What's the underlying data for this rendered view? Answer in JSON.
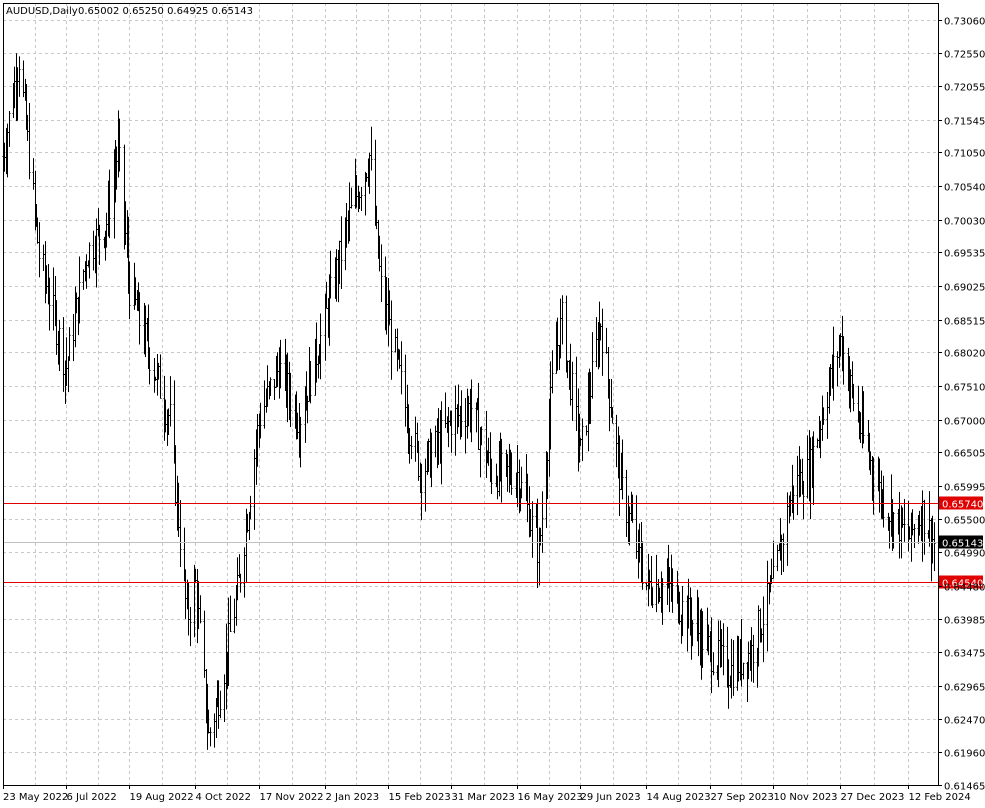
{
  "header": {
    "symbol": "AUDUSD,Daily",
    "ohlc": "0.65002 0.65250 0.64925 0.65143"
  },
  "colors": {
    "background": "#ffffff",
    "grid": "#c8c8c8",
    "bars": "#000000",
    "level_line": "#e00000",
    "current_line": "#c0c0c0"
  },
  "chart_data": {
    "type": "bar",
    "ylim": [
      0.61465,
      0.7331
    ],
    "yticks": [
      "0.73060",
      "0.72550",
      "0.72055",
      "0.71545",
      "0.71050",
      "0.70540",
      "0.70030",
      "0.69535",
      "0.69025",
      "0.68515",
      "0.68020",
      "0.67510",
      "0.67000",
      "0.66505",
      "0.65995",
      "0.65500",
      "0.64990",
      "0.64480",
      "0.63985",
      "0.63475",
      "0.62965",
      "0.62470",
      "0.61960",
      "0.61465"
    ],
    "xticks": [
      "23 May 2022",
      "6 Jul 2022",
      "19 Aug 2022",
      "4 Oct 2022",
      "17 Nov 2022",
      "2 Jan 2023",
      "15 Feb 2023",
      "31 Mar 2023",
      "16 May 2023",
      "29 Jun 2023",
      "14 Aug 2023",
      "27 Sep 2023",
      "10 Nov 2023",
      "27 Dec 2023",
      "12 Feb 2024"
    ],
    "anchors": [
      [
        "23 May 2022",
        0.71
      ],
      [
        "3 Jun 2022",
        0.725
      ],
      [
        "17 Jun 2022",
        0.695
      ],
      [
        "6 Jul 2022",
        0.678
      ],
      [
        "20 Jul 2022",
        0.695
      ],
      [
        "3 Aug 2022",
        0.7
      ],
      [
        "11 Aug 2022",
        0.711
      ],
      [
        "19 Aug 2022",
        0.69
      ],
      [
        "2 Sep 2022",
        0.68
      ],
      [
        "16 Sep 2022",
        0.67
      ],
      [
        "28 Sep 2022",
        0.64
      ],
      [
        "4 Oct 2022",
        0.645
      ],
      [
        "13 Oct 2022",
        0.622
      ],
      [
        "22 Oct 2022",
        0.63
      ],
      [
        "3 Nov 2022",
        0.645
      ],
      [
        "17 Nov 2022",
        0.67
      ],
      [
        "1 Dec 2022",
        0.678
      ],
      [
        "15 Dec 2022",
        0.67
      ],
      [
        "2 Jan 2023",
        0.685
      ],
      [
        "18 Jan 2023",
        0.7
      ],
      [
        "2 Feb 2023",
        0.71
      ],
      [
        "10 Feb 2023",
        0.69
      ],
      [
        "15 Feb 2023",
        0.685
      ],
      [
        "1 Mar 2023",
        0.67
      ],
      [
        "10 Mar 2023",
        0.662
      ],
      [
        "31 Mar 2023",
        0.67
      ],
      [
        "14 Apr 2023",
        0.672
      ],
      [
        "28 Apr 2023",
        0.662
      ],
      [
        "16 May 2023",
        0.662
      ],
      [
        "31 May 2023",
        0.65
      ],
      [
        "10 Jun 2023",
        0.678
      ],
      [
        "16 Jun 2023",
        0.685
      ],
      [
        "29 Jun 2023",
        0.665
      ],
      [
        "13 Jul 2023",
        0.685
      ],
      [
        "27 Jul 2023",
        0.66
      ],
      [
        "14 Aug 2023",
        0.645
      ],
      [
        "28 Aug 2023",
        0.645
      ],
      [
        "13 Sep 2023",
        0.64
      ],
      [
        "27 Sep 2023",
        0.635
      ],
      [
        "11 Oct 2023",
        0.632
      ],
      [
        "26 Oct 2023",
        0.635
      ],
      [
        "10 Nov 2023",
        0.645
      ],
      [
        "24 Nov 2023",
        0.66
      ],
      [
        "5 Dec 2023",
        0.662
      ],
      [
        "13 Dec 2023",
        0.67
      ],
      [
        "27 Dec 2023",
        0.682
      ],
      [
        "8 Jan 2024",
        0.67
      ],
      [
        "25 Jan 2024",
        0.658
      ],
      [
        "12 Feb 2024",
        0.652
      ],
      [
        "22 Feb 2024",
        0.656
      ],
      [
        "1 Mar 2024",
        0.6514
      ]
    ],
    "horizontal_levels": [
      {
        "price": 0.6574,
        "label": "0.65740",
        "color": "#e00000"
      },
      {
        "price": 0.6454,
        "label": "0.64540",
        "color": "#e00000"
      }
    ],
    "current_price": {
      "price": 0.65143,
      "label": "0.65143"
    },
    "grid": true
  }
}
